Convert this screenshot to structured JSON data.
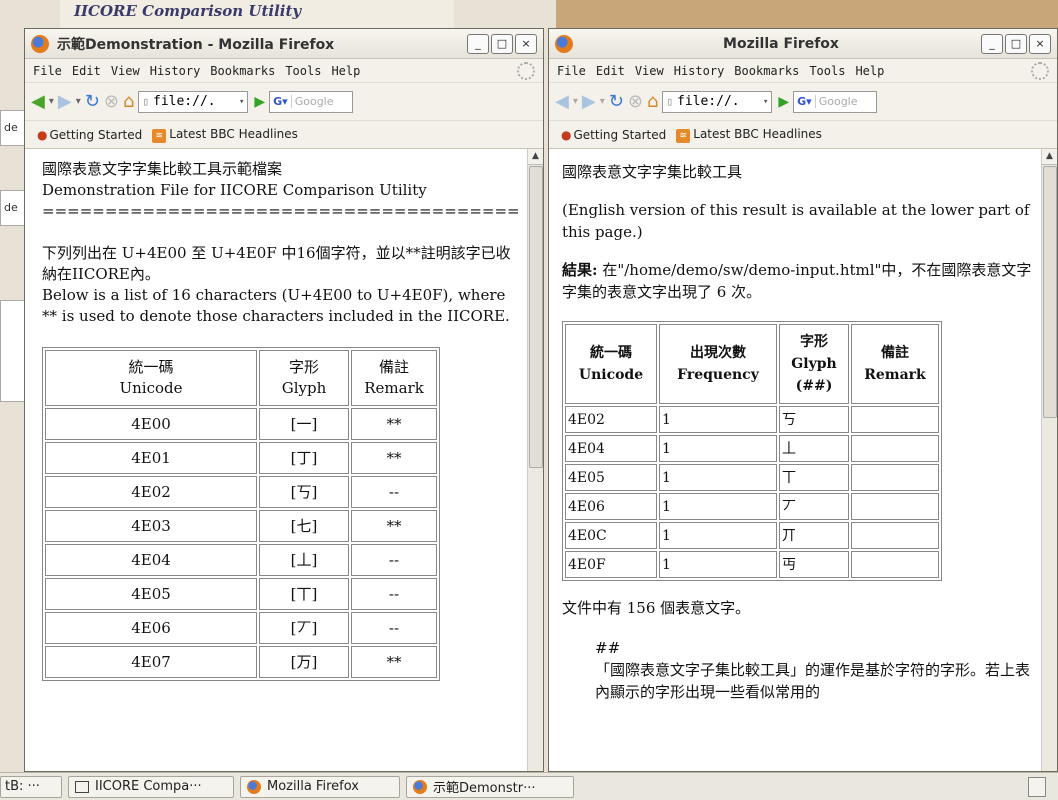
{
  "background": {
    "top_text": "IICORE Comparison Utility",
    "strip1": "de",
    "strip2": "de"
  },
  "left_window": {
    "title": "示範Demonstration - Mozilla Firefox",
    "menu": [
      "File",
      "Edit",
      "View",
      "History",
      "Bookmarks",
      "Tools",
      "Help"
    ],
    "url": "file://.",
    "search_placeholder": "Google",
    "bookmarks": [
      "Getting Started",
      "Latest BBC Headlines"
    ],
    "content": {
      "heading_zh": "國際表意文字字集比較工具示範檔案",
      "heading_en": "Demonstration File for IICORE Comparison Utility",
      "rule": "================================================",
      "intro_zh": "下列列出在 U+4E00 至 U+4E0F 中16個字符，並以**註明該字已收納在IICORE內。",
      "intro_en": "Below is a list of 16 characters (U+4E00 to U+4E0F), where ** is used to denote those characters included in the IICORE.",
      "table_header": [
        [
          "統一碼",
          "Unicode"
        ],
        [
          "字形",
          "Glyph"
        ],
        [
          "備註",
          "Remark"
        ]
      ],
      "rows": [
        [
          "4E00",
          "[一]",
          "**"
        ],
        [
          "4E01",
          "[丁]",
          "**"
        ],
        [
          "4E02",
          "[丂]",
          "--"
        ],
        [
          "4E03",
          "[七]",
          "**"
        ],
        [
          "4E04",
          "[丄]",
          "--"
        ],
        [
          "4E05",
          "[丅]",
          "--"
        ],
        [
          "4E06",
          "[丆]",
          "--"
        ],
        [
          "4E07",
          "[万]",
          "**"
        ]
      ]
    }
  },
  "right_window": {
    "title": "Mozilla Firefox",
    "menu": [
      "File",
      "Edit",
      "View",
      "History",
      "Bookmarks",
      "Tools",
      "Help"
    ],
    "url": "file://.",
    "search_placeholder": "Google",
    "bookmarks": [
      "Getting Started",
      "Latest BBC Headlines"
    ],
    "content": {
      "heading": "國際表意文字字集比較工具",
      "english_note": "(English version of this result is available at the lower part of this page.)",
      "result_label": "結果:",
      "result_text": "在\"/home/demo/sw/demo-input.html\"中，不在國際表意文字字集的表意文字出現了 6 次。",
      "table_header": [
        [
          "統一碼",
          "Unicode"
        ],
        [
          "出現次數",
          "Frequency"
        ],
        [
          "字形",
          "Glyph",
          "(##)"
        ],
        [
          "備註",
          "Remark"
        ]
      ],
      "rows": [
        [
          "4E02",
          "1",
          "丂",
          ""
        ],
        [
          "4E04",
          "1",
          "丄",
          ""
        ],
        [
          "4E05",
          "1",
          "丅",
          ""
        ],
        [
          "4E06",
          "1",
          "丆",
          ""
        ],
        [
          "4E0C",
          "1",
          "丌",
          ""
        ],
        [
          "4E0F",
          "1",
          "丏",
          ""
        ]
      ],
      "total": "文件中有 156 個表意文字。",
      "hash": "##",
      "para": "「國際表意文字子集比較工具」的運作是基於字符的字形。若上表內顯示的字形出現一些看似常用的"
    }
  },
  "taskbar": {
    "items": [
      "tB: ···",
      "IICORE Compa···",
      "Mozilla Firefox",
      "示範Demonstr···"
    ]
  }
}
